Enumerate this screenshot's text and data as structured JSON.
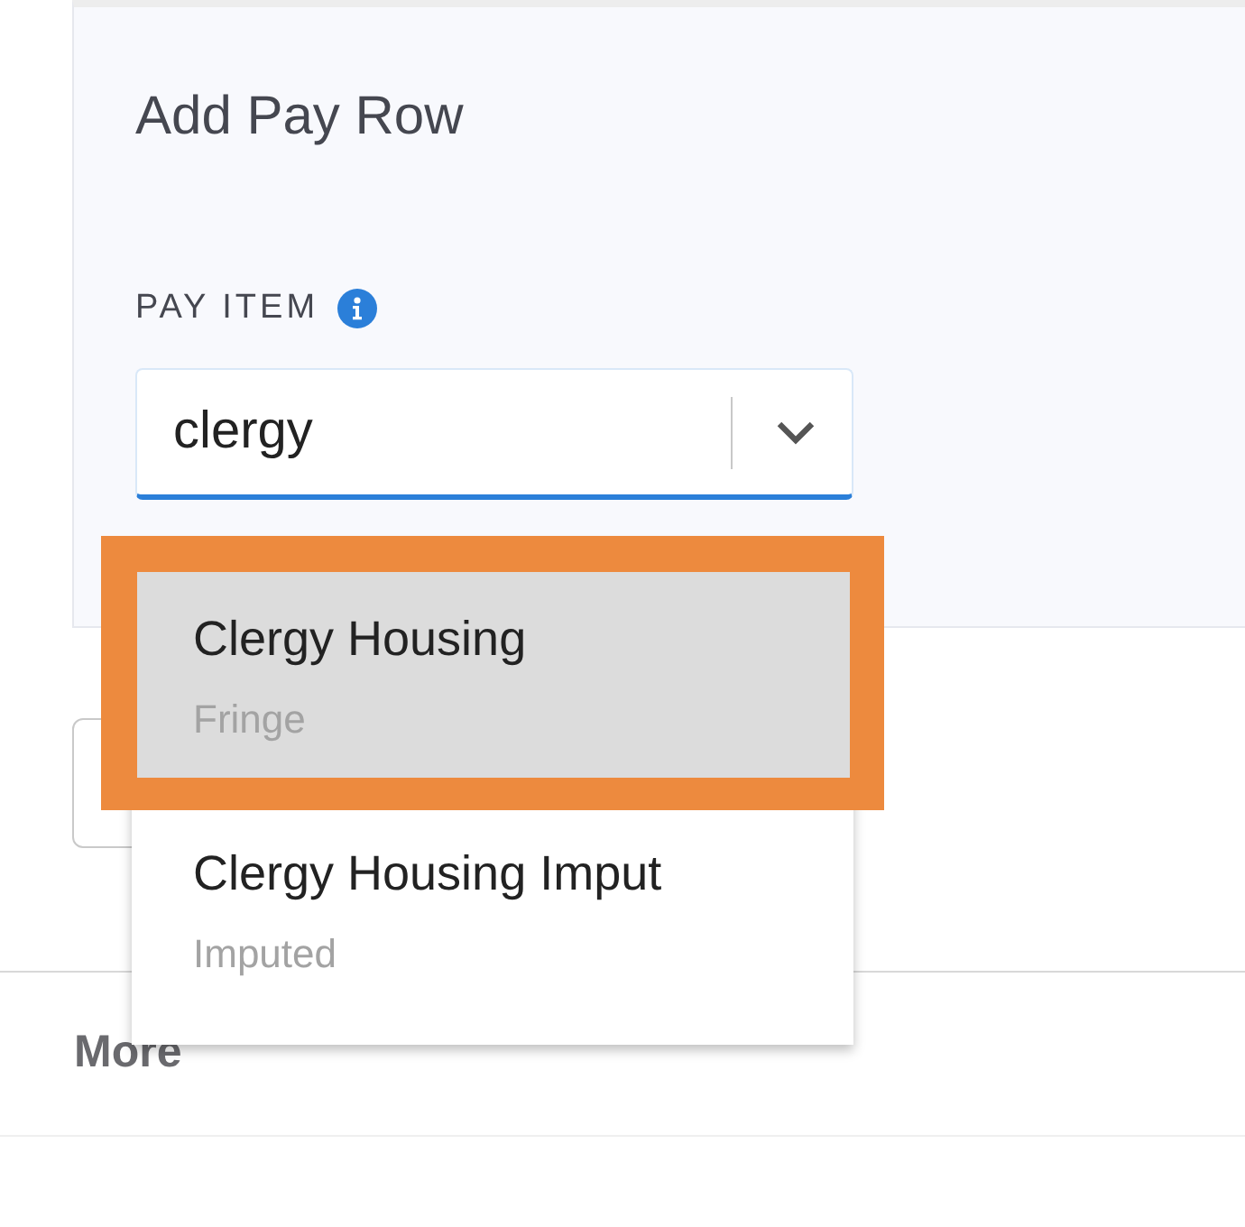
{
  "dialog": {
    "title": "Add Pay Row"
  },
  "pay_item": {
    "label": "PAY ITEM",
    "value": "clergy"
  },
  "options": [
    {
      "name": "Clergy Housing",
      "category": "Fringe",
      "selected": true
    },
    {
      "name": "Clergy Housing Imput",
      "category": "Imputed",
      "selected": false
    }
  ],
  "section": {
    "title": "More"
  }
}
